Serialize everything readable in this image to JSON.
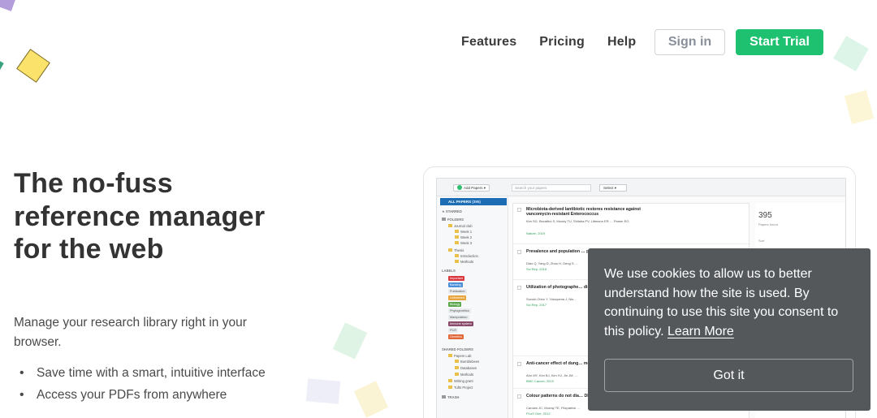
{
  "nav": {
    "links": [
      "Features",
      "Pricing",
      "Help"
    ],
    "sign_in": "Sign in",
    "start_trial": "Start Trial"
  },
  "hero": {
    "title": "The no-fuss reference manager for the web",
    "subtitle": "Manage your research library right in your browser.",
    "bullets": [
      "Save time with a smart, intuitive interface",
      "Access your PDFs from anywhere"
    ]
  },
  "app": {
    "toolbar": {
      "add_papers": "Add Papers ▾",
      "search_placeholder": "Search your papers",
      "select": "Select ▾"
    },
    "sidebar": {
      "all_papers": "ALL PAPERS",
      "all_count": "(395)",
      "starred": "STARRED",
      "folders": "FOLDERS",
      "journal_club": "Journal club",
      "week1": "Week 1",
      "week2": "Week 2",
      "week3": "Week 3",
      "thesis": "Thesis",
      "introduction": "Introduction",
      "methods": "Methods",
      "labels": "LABELS",
      "label_items": [
        "Important",
        "Banking",
        "Publication",
        "Unfinished",
        "Biology",
        "Phylogenetics",
        "Manipulation",
        "Immune system",
        "PCR",
        "Genetics"
      ],
      "shared_folders": "SHARED FOLDERS",
      "shared_items": [
        "Papers Lab",
        "Bumblebees",
        "Databases",
        "Methods",
        "Writing grant",
        "Tufts Project"
      ],
      "trash": "TRASH"
    },
    "papers": [
      {
        "title": "Microbiota-derived lantibiotic restores resistance against vancomycin-resistant Enterococcus",
        "authors": "Kim SG, Becattini S, Moody TU, Shliaha PV, Littmann ER … Pamer EG",
        "journal": "Nature, 2019"
      },
      {
        "title": "Prevalence and population … pathogen DWV in Chinese …",
        "authors": "Diao Q, Yang D, Zhao H, Deng S, …",
        "journal": "Sci Rep, 2018"
      },
      {
        "title": "Utilization of photographe… distributions",
        "authors": "Suzuki-Ohno Y, Yokoyama J, Nis…",
        "journal": "Sci Rep, 2017"
      },
      {
        "title": "Anti-cancer effect of dung… melanoma",
        "authors": "Ahn MY, Kim BJ, Kim HJ, Jin JM, …",
        "journal": "BMC Cancer, 2019"
      },
      {
        "title": "Colour patterns do not dia… DNA barcoded cryptic bu…",
        "authors": "Carolan JC, Murray TE, Fitzpatrick …",
        "journal": "PLoS One, 2012"
      }
    ],
    "info": {
      "count": "395",
      "found": "Papers found",
      "sort": "Sort"
    }
  },
  "cookie": {
    "text": "We use cookies to allow us to better understand how the site is used. By continuing to use this site you consent to this policy.",
    "learn_more": "Learn More",
    "button": "Got it"
  }
}
